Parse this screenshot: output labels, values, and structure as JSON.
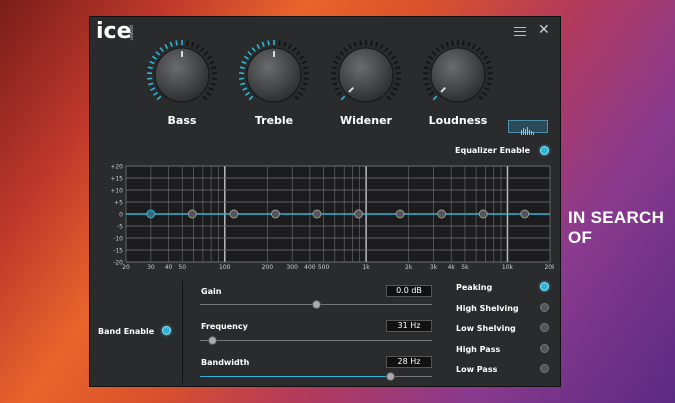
{
  "background_text": "IN SEARCH OF",
  "app": {
    "logo": "ice",
    "logo_sub": "power"
  },
  "knobs": [
    {
      "label": "Bass",
      "level": 0.5
    },
    {
      "label": "Treble",
      "level": 0.5
    },
    {
      "label": "Widener",
      "level": 0.0
    },
    {
      "label": "Loudness",
      "level": 0.0
    }
  ],
  "equalizer": {
    "enable_label": "Equalizer Enable",
    "enabled": true,
    "y_ticks": [
      "+20",
      "+15",
      "+10",
      "+5",
      "0",
      "-5",
      "-10",
      "-15",
      "-20"
    ],
    "x_ticks": [
      "20",
      "30",
      "40",
      "50",
      "100",
      "200",
      "300",
      "400",
      "500",
      "1k",
      "2k",
      "3k",
      "4k",
      "5k",
      "10k",
      "20k"
    ],
    "band_points": [
      30,
      50,
      80,
      130,
      210,
      340,
      560,
      900,
      1500,
      2400
    ],
    "band_gain_db": [
      0,
      0,
      0,
      0,
      0,
      0,
      0,
      0,
      0,
      0
    ],
    "accent_color": "#2fb5d8"
  },
  "band": {
    "enable_label": "Band Enable",
    "enabled": true,
    "gain": {
      "label": "Gain",
      "value": "0.0 dB",
      "level": 0.5
    },
    "frequency": {
      "label": "Frequency",
      "value": "31 Hz",
      "level": 0.05
    },
    "bandwidth": {
      "label": "Bandwidth",
      "value": "28 Hz",
      "level": 0.82
    }
  },
  "filters": [
    {
      "label": "Peaking",
      "selected": true
    },
    {
      "label": "High Shelving",
      "selected": false
    },
    {
      "label": "Low Shelving",
      "selected": false
    },
    {
      "label": "High Pass",
      "selected": false
    },
    {
      "label": "Low Pass",
      "selected": false
    }
  ]
}
